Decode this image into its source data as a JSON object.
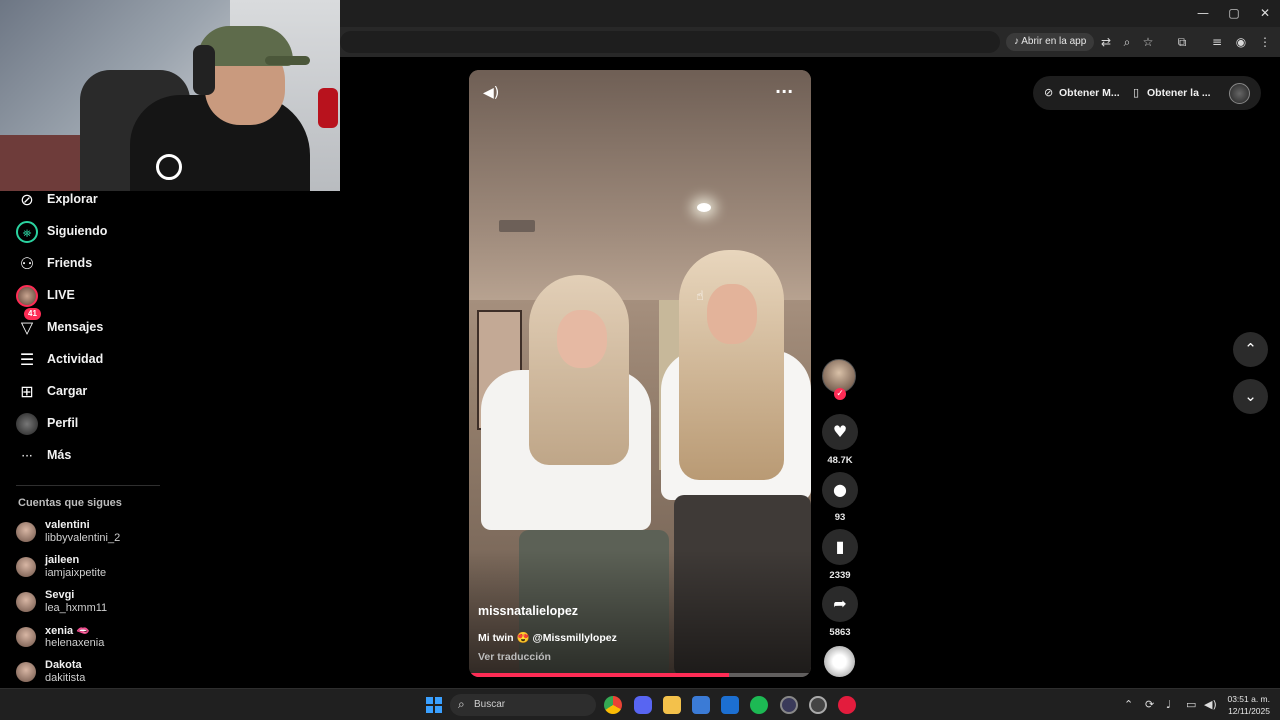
{
  "browser": {
    "open_in_app": "Abrir en la app",
    "window_controls": [
      "—",
      "▢",
      "✕"
    ]
  },
  "nav": {
    "items": [
      {
        "label": "Explorar",
        "icon": "compass-icon",
        "glyph": "⊘"
      },
      {
        "label": "Siguiendo",
        "icon": "following-icon",
        "glyph": "⛯"
      },
      {
        "label": "Friends",
        "icon": "friends-icon",
        "glyph": "⚇"
      },
      {
        "label": "LIVE",
        "icon": "live-avatar-icon",
        "glyph": ""
      },
      {
        "label": "Mensajes",
        "icon": "messages-icon",
        "glyph": "▽",
        "badge": "41"
      },
      {
        "label": "Actividad",
        "icon": "activity-icon",
        "glyph": "☰"
      },
      {
        "label": "Cargar",
        "icon": "upload-icon",
        "glyph": "⊞"
      },
      {
        "label": "Perfil",
        "icon": "profile-avatar-icon",
        "glyph": ""
      },
      {
        "label": "Más",
        "icon": "more-icon",
        "glyph": "···"
      }
    ],
    "following_title": "Cuentas que sigues",
    "following": [
      {
        "name": "valentini",
        "handle": "libbyvalentini_2"
      },
      {
        "name": "jaileen",
        "handle": "iamjaixpetite"
      },
      {
        "name": "Sevgi",
        "handle": "lea_hxmm11"
      },
      {
        "name": "xenia 🫦",
        "handle": "helenaxenia"
      },
      {
        "name": "Dakota",
        "handle": "dakitista"
      }
    ]
  },
  "video": {
    "author": "missnatalielopez",
    "caption": "Mi twin 😍 @Missmillylopez",
    "translate": "Ver traducción",
    "progress": 0.76
  },
  "actions": {
    "likes": "48.7K",
    "comments": "93",
    "saves": "2339",
    "shares": "5863"
  },
  "top_buttons": {
    "get_coins": "Obtener M...",
    "get_app": "Obtener la ..."
  },
  "taskbar": {
    "search_placeholder": "Buscar",
    "time": "03:51 a. m.",
    "date": "12/11/2025"
  },
  "colors": {
    "accent": "#fe2c55",
    "background": "#000000",
    "panel": "#1e1e1e"
  }
}
